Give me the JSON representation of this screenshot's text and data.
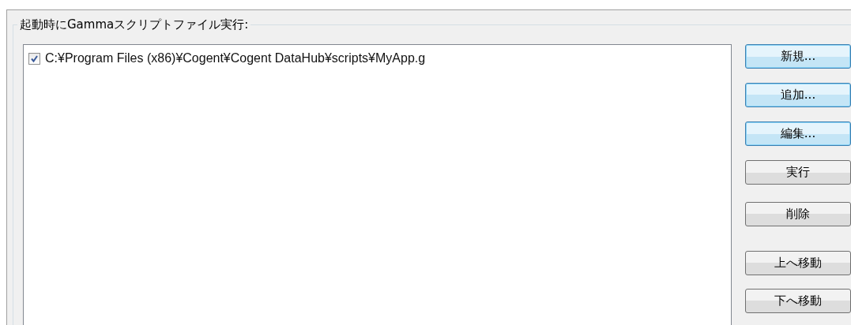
{
  "group": {
    "title": "起動時にGammaスクリプトファイル実行:"
  },
  "scripts": [
    {
      "path": "C:¥Program Files (x86)¥Cogent¥Cogent DataHub¥scripts¥MyApp.g",
      "checked": true
    }
  ],
  "buttons": [
    {
      "label": "新規...",
      "highlighted": true
    },
    {
      "label": "追加...",
      "highlighted": true
    },
    {
      "label": "編集...",
      "highlighted": true
    },
    {
      "label": "実行",
      "highlighted": false
    },
    {
      "label": "削除",
      "highlighted": false
    },
    {
      "label": "上へ移動",
      "highlighted": false
    },
    {
      "label": "下へ移動",
      "highlighted": false
    }
  ]
}
